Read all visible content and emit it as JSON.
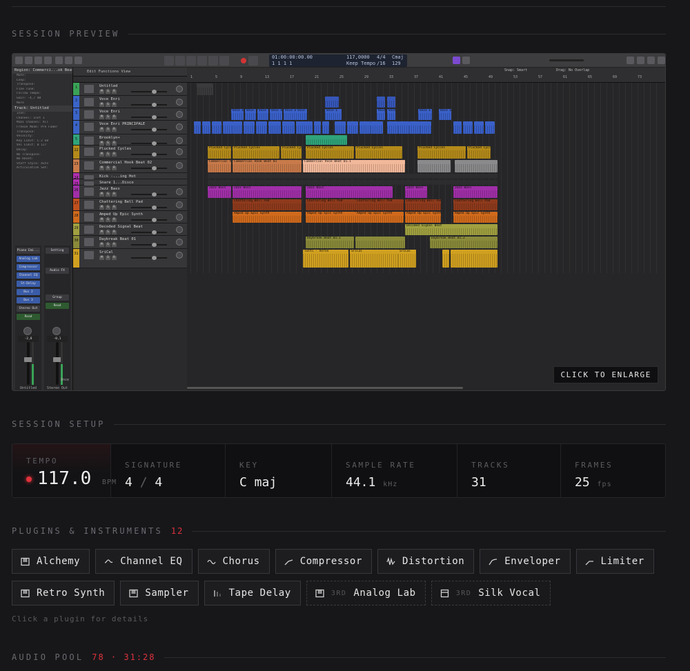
{
  "sections": {
    "preview_title": "SESSION PREVIEW",
    "setup_title": "SESSION SETUP",
    "plugins_title": "PLUGINS & INSTRUMENTS",
    "plugins_count": "12",
    "audio_pool_title": "AUDIO POOL",
    "audio_pool_count": "78 · 31:28"
  },
  "preview": {
    "enlarge_label": "CLICK TO ENLARGE",
    "lcd": {
      "time": "01:00:00:00.00",
      "bars": "1 1 1 1",
      "tempo": "117,0000",
      "keep_tempo": "Keep Tempo",
      "signature": "4/4",
      "division": "/16",
      "key": "Cmaj",
      "value_129": "129"
    },
    "inspector": {
      "region_header": "Region: Commerci...ok Beat 01.1",
      "region_rows": [
        "Mute:",
        "Loop:",
        "Transpose:",
        "Fine Tune:",
        "Follow Tempo:",
        "Gain: -4,7 dB",
        "More"
      ],
      "track_header": "Track: Untitled",
      "track_rows": [
        "Icon:",
        "Channel: Inst 1",
        "MIDI Channel: All",
        "Freeze Mode: Pre Fader",
        "Transpose:",
        "Velocity:",
        "Key Limit: C-2 G8",
        "Vel Limit: 0 127",
        "Delay:",
        "No Transpose:",
        "No Reset:",
        "Staff Style: Auto",
        "Articulation Set:"
      ],
      "strip_left": {
        "slots": [
          "Piano Emi...",
          "Analog Lab",
          "Compressor",
          "Channel EQ",
          "St-Delay",
          "Bus 2",
          "Bus 3",
          "Stereo Out",
          "Read"
        ],
        "name": "Untitled",
        "value": "-2,8"
      },
      "strip_right": {
        "slots": [
          "Setting",
          "Audio FX",
          "Group",
          "Read"
        ],
        "name": "Stereo Out",
        "value": "-0,1",
        "extra": "Bnce"
      }
    },
    "toolbar": {
      "items": "Edit   Functions   View",
      "snap": "Snap: Smart",
      "drag": "Drag: No Overlap"
    },
    "ruler": [
      "1",
      "5",
      "9",
      "13",
      "17",
      "21",
      "25",
      "29",
      "33",
      "37",
      "41",
      "45",
      "49",
      "53",
      "57",
      "61",
      "65",
      "69",
      "73"
    ],
    "tracks": [
      {
        "num": "1",
        "name": "Untitled",
        "color": "#3aa357"
      },
      {
        "num": "2",
        "name": "Voce Enri",
        "color": "#3a64c8"
      },
      {
        "num": "3",
        "name": "Voce Enri",
        "color": "#3a64c8"
      },
      {
        "num": "4",
        "name": "Voce Enri PRINCIPALE",
        "color": "#3a64c8"
      },
      {
        "num": "5",
        "name": "Brooklyn+",
        "color": "#2fa37a"
      },
      {
        "num": "22",
        "name": "Plucked Cycles",
        "color": "#b38a1a"
      },
      {
        "num": "23",
        "name": "Commercial Hook Beat 02",
        "color": "#c87a4a"
      },
      {
        "num": "24",
        "name": "Kick -...ing Hot",
        "color": "#b02fb0"
      },
      {
        "num": "25",
        "name": "Snare 1...Disco",
        "color": "#b02fb0"
      },
      {
        "num": "26",
        "name": "Jazz Bass",
        "color": "#a02fa8"
      },
      {
        "num": "27",
        "name": "Chattering Bell Pad",
        "color": "#c0501e"
      },
      {
        "num": "28",
        "name": "Amped Up Epic Synth",
        "color": "#d06a1c"
      },
      {
        "num": "29",
        "name": "Decoded Signal Beat",
        "color": "#a0a040"
      },
      {
        "num": "30",
        "name": "Daybreak Beat 01",
        "color": "#8a8a3a"
      },
      {
        "num": "31",
        "name": "SriCal",
        "color": "#d0a020"
      }
    ],
    "regions": {
      "voce": "Voce E",
      "plucked": "Plucked Cycles",
      "commercial": "Commercial Hook Beat 01",
      "commercial2": "Commercial Voce Beat 01.1",
      "jazz": "Jazz Bass",
      "bell": "Chattering Bell Pad",
      "amped": "Amped Up Epic Synth",
      "decoded": "Decoded Signal Beat",
      "daybreak": "Daybreak Beat 01.1",
      "daybreak2": "Daybreak Beat 01.2",
      "tutti": "Tutti - Verse",
      "srical": "SriCal"
    }
  },
  "setup": {
    "tempo": {
      "label": "TEMPO",
      "value": "117.0",
      "unit": "BPM"
    },
    "signature": {
      "label": "SIGNATURE",
      "num": "4",
      "sep": "/",
      "den": "4"
    },
    "key": {
      "label": "KEY",
      "value": "C maj"
    },
    "sample_rate": {
      "label": "SAMPLE RATE",
      "value": "44.1",
      "unit": "kHz"
    },
    "tracks": {
      "label": "TRACKS",
      "value": "31"
    },
    "frames": {
      "label": "FRAMES",
      "value": "25",
      "unit": "fps"
    }
  },
  "plugins": {
    "row1": [
      {
        "name": "Alchemy",
        "icon": "keyboard-icon"
      },
      {
        "name": "Channel EQ",
        "icon": "eq-curve-icon"
      },
      {
        "name": "Chorus",
        "icon": "wave-icon"
      },
      {
        "name": "Compressor",
        "icon": "compressor-curve-icon"
      },
      {
        "name": "Distortion",
        "icon": "distortion-icon"
      },
      {
        "name": "Enveloper",
        "icon": "envelope-curve-icon"
      },
      {
        "name": "Limiter",
        "icon": "limiter-curve-icon"
      }
    ],
    "row2": [
      {
        "name": "Retro Synth",
        "icon": "keyboard-icon"
      },
      {
        "name": "Sampler",
        "icon": "keyboard-icon"
      },
      {
        "name": "Tape Delay",
        "icon": "delay-bars-icon"
      },
      {
        "name": "Analog Lab",
        "icon": "keyboard-icon",
        "tag": "3RD"
      },
      {
        "name": "Silk Vocal",
        "icon": "box-icon",
        "tag": "3RD"
      }
    ],
    "hint": "Click a plugin for details"
  },
  "colors": {
    "accent": "#e0323c",
    "bg": "#17171a"
  }
}
